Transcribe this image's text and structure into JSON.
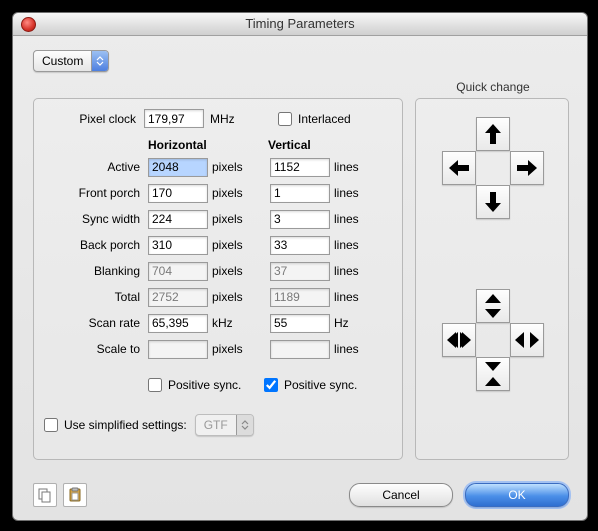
{
  "title": "Timing Parameters",
  "preset": {
    "label": "Custom"
  },
  "pixel_clock": {
    "label": "Pixel clock",
    "value": "179,97",
    "unit": "MHz"
  },
  "interlaced": {
    "label": "Interlaced",
    "checked": false
  },
  "columns": {
    "h": "Horizontal",
    "v": "Vertical"
  },
  "rows": {
    "active": {
      "label": "Active",
      "h": "2048",
      "hu": "pixels",
      "v": "1152",
      "vu": "lines"
    },
    "front_porch": {
      "label": "Front porch",
      "h": "170",
      "hu": "pixels",
      "v": "1",
      "vu": "lines"
    },
    "sync_width": {
      "label": "Sync width",
      "h": "224",
      "hu": "pixels",
      "v": "3",
      "vu": "lines"
    },
    "back_porch": {
      "label": "Back porch",
      "h": "310",
      "hu": "pixels",
      "v": "33",
      "vu": "lines"
    },
    "blanking": {
      "label": "Blanking",
      "h": "704",
      "hu": "pixels",
      "v": "37",
      "vu": "lines"
    },
    "total": {
      "label": "Total",
      "h": "2752",
      "hu": "pixels",
      "v": "1189",
      "vu": "lines"
    },
    "scan_rate": {
      "label": "Scan rate",
      "h": "65,395",
      "hu": "kHz",
      "v": "55",
      "vu": "Hz"
    },
    "scale_to": {
      "label": "Scale to",
      "h": "",
      "hu": "pixels",
      "v": "",
      "vu": "lines"
    }
  },
  "positive_sync": {
    "label": "Positive sync.",
    "h_checked": false,
    "v_checked": true
  },
  "simplified": {
    "label": "Use simplified settings:",
    "checked": false,
    "option": "GTF"
  },
  "quick_change": {
    "label": "Quick change"
  },
  "buttons": {
    "cancel": "Cancel",
    "ok": "OK"
  }
}
